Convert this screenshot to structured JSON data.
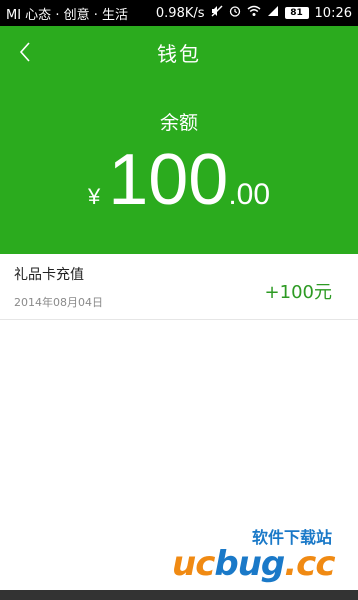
{
  "status_bar": {
    "left_text": "MI 心态 · 创意 · 生活",
    "speed": "0.98K/s",
    "battery": "81",
    "time": "10:26"
  },
  "header": {
    "title": "钱包",
    "balance_label": "余额",
    "currency": "¥",
    "amount_integer": "100",
    "amount_decimal": ".00"
  },
  "records": [
    {
      "title": "礼品卡充值",
      "date": "2014年08月04日",
      "amount": "+100元"
    }
  ],
  "watermark": {
    "logo_text_orange": "uc",
    "logo_text_blue": "bug",
    "logo_text_tail": ".cc",
    "subtitle": "软件下载站"
  },
  "colors": {
    "header_bg": "#2bab1e",
    "amount_green": "#2d9a23"
  }
}
